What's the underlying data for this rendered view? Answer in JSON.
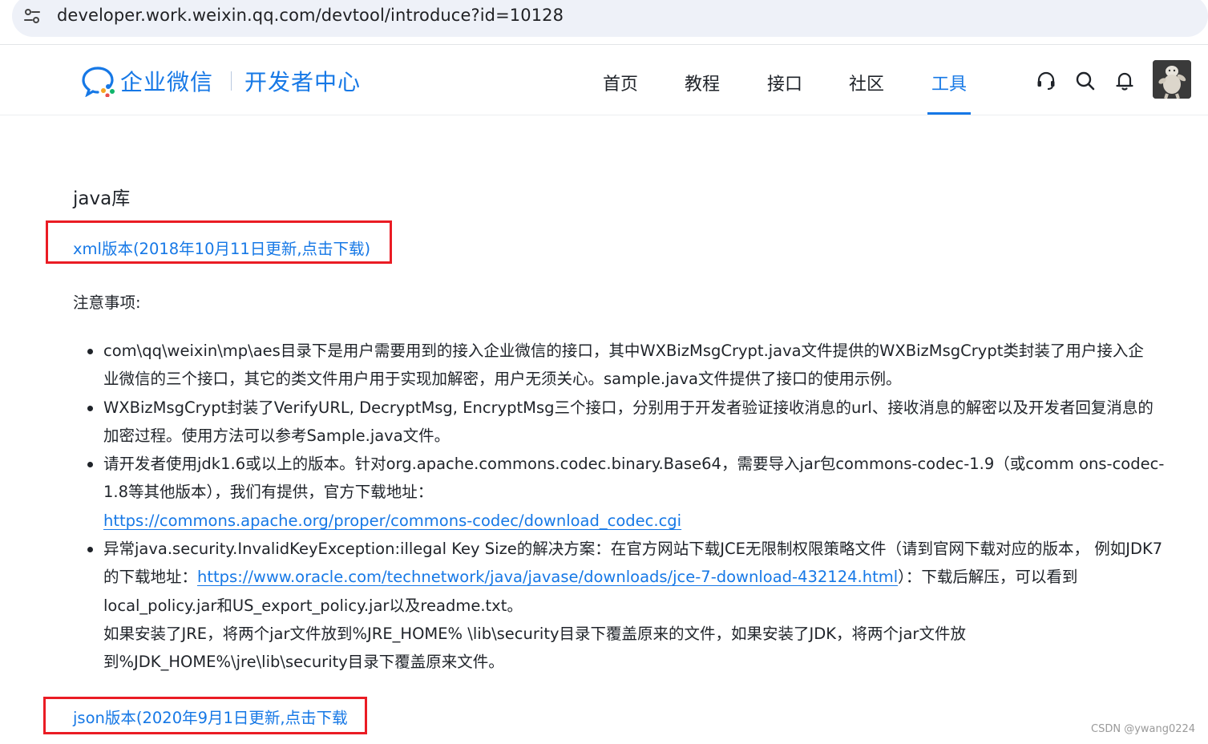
{
  "browser": {
    "url": "developer.work.weixin.qq.com/devtool/introduce?id=10128"
  },
  "header": {
    "logo_text": "企业微信",
    "logo_sub": "开发者中心",
    "nav": [
      {
        "label": "首页"
      },
      {
        "label": "教程"
      },
      {
        "label": "接口"
      },
      {
        "label": "社区"
      },
      {
        "label": "工具",
        "active": true
      }
    ],
    "accent_color": "#1678e6"
  },
  "content": {
    "section_title": "java库",
    "xml_download": "xml版本(2018年10月11日更新,点击下载)",
    "notes_title": "注意事项:",
    "bullets": [
      {
        "lines": [
          "com\\qq\\weixin\\mp\\aes目录下是用户需要用到的接入企业微信的接口，其中WXBizMsgCrypt.java文件提供的WXBizMsgCrypt类封装了用户接入企",
          "业微信的三个接口，其它的类文件用户用于实现加解密，用户无须关心。sample.java文件提供了接口的使用示例。"
        ]
      },
      {
        "lines": [
          "WXBizMsgCrypt封装了VerifyURL, DecryptMsg, EncryptMsg三个接口，分别用于开发者验证接收消息的url、接收消息的解密以及开发者回复消息的",
          "加密过程。使用方法可以参考Sample.java文件。"
        ]
      },
      {
        "lines": [
          "请开发者使用jdk1.6或以上的版本。针对org.apache.commons.codec.binary.Base64，需要导入jar包commons-codec-1.9（或comm ons-codec-",
          "1.8等其他版本），我们有提供，官方下载地址："
        ],
        "link": "https://commons.apache.org/proper/commons-codec/download_codec.cgi"
      },
      {
        "line1": "异常java.security.InvalidKeyException:illegal Key Size的解决方案：在官方网站下载JCE无限制权限策略文件（请到官网下载对应的版本， 例如JDK7",
        "line2_prefix": "的下载地址：",
        "line2_link": "https://www.oracle.com/technetwork/java/javase/downloads/jce-7-download-432124.html",
        "line2_suffix": "）：下载后解压，可以看到",
        "line3": "local_policy.jar和US_export_policy.jar以及readme.txt。",
        "line4": "如果安装了JRE，将两个jar文件放到%JRE_HOME% \\lib\\security目录下覆盖原来的文件，如果安装了JDK，将两个jar文件放",
        "line5": "到%JDK_HOME%\\jre\\lib\\security目录下覆盖原来文件。"
      }
    ],
    "json_download": "json版本(2020年9月1日更新,点击下载",
    "highlight_color": "#ea1c24"
  },
  "watermark": "CSDN @ywang0224"
}
